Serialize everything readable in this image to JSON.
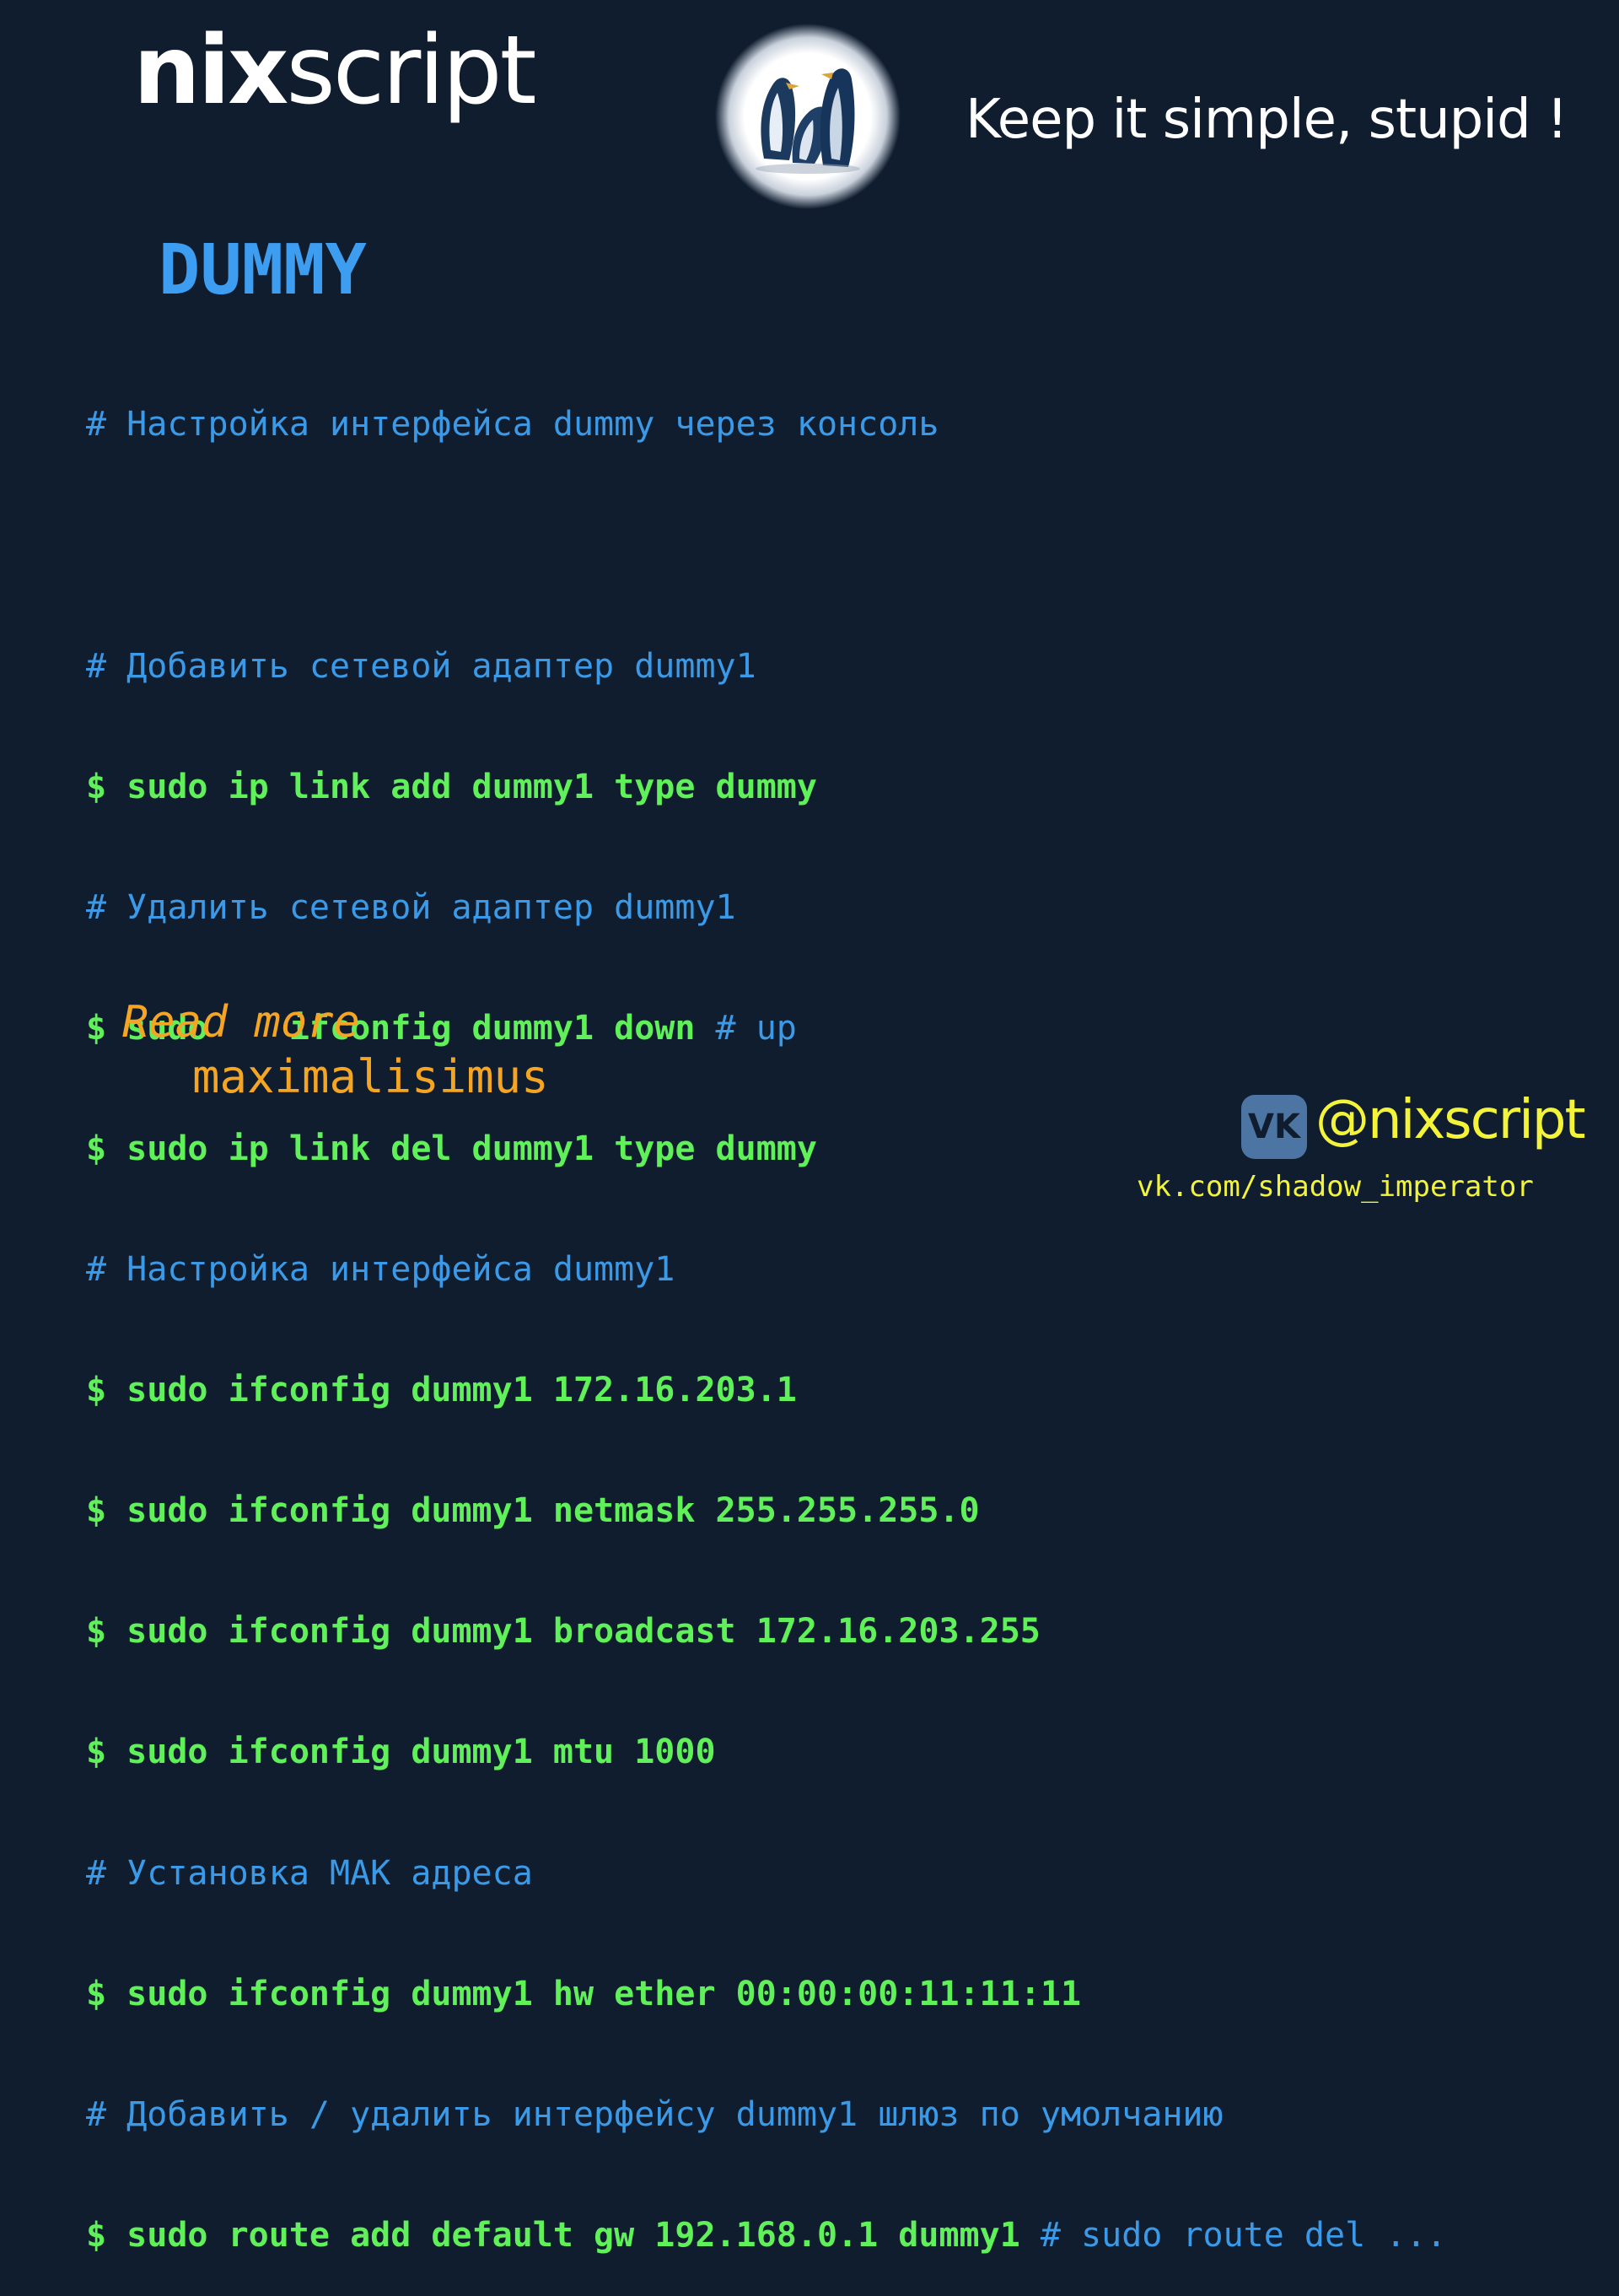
{
  "header": {
    "logo_bold": "nix",
    "logo_thin": "script",
    "motto": "Keep it simple, stupid !"
  },
  "title": "DUMMY",
  "code_lines": [
    {
      "type": "comment",
      "text": "# Настройка интерфейса dummy через консоль"
    },
    {
      "type": "blank",
      "text": ""
    },
    {
      "type": "comment",
      "text": "# Добавить сетевой адаптер dummy1"
    },
    {
      "type": "cmd",
      "text": "$ sudo ip link add dummy1 type dummy"
    },
    {
      "type": "comment",
      "text": "# Удалить сетевой адаптер dummy1"
    },
    {
      "type": "cmd",
      "text": "$ sudo    ifconfig dummy1 down",
      "trail": " # up"
    },
    {
      "type": "cmd",
      "text": "$ sudo ip link del dummy1 type dummy"
    },
    {
      "type": "comment",
      "text": "# Настройка интерфейса dummy1"
    },
    {
      "type": "cmd",
      "text": "$ sudo ifconfig dummy1 172.16.203.1"
    },
    {
      "type": "cmd",
      "text": "$ sudo ifconfig dummy1 netmask 255.255.255.0"
    },
    {
      "type": "cmd",
      "text": "$ sudo ifconfig dummy1 broadcast 172.16.203.255"
    },
    {
      "type": "cmd",
      "text": "$ sudo ifconfig dummy1 mtu 1000"
    },
    {
      "type": "comment",
      "text": "# Установка MAK адреса"
    },
    {
      "type": "cmd",
      "text": "$ sudo ifconfig dummy1 hw ether 00:00:00:11:11:11"
    },
    {
      "type": "comment",
      "text": "# Добавить / удалить интерфейсу dummy1 шлюз по умолчанию"
    },
    {
      "type": "cmd",
      "text": "$ sudo route add default gw 192.168.0.1 dummy1",
      "trail": " # sudo route del ..."
    }
  ],
  "footer": {
    "read_more": "Read more",
    "link": "maximalisimus",
    "vk_badge": "VK",
    "handle": "@nixscript",
    "vk_url": "vk.com/shadow_imperator"
  },
  "colors": {
    "background": "#0f1d2f",
    "comment": "#3b9ae8",
    "command": "#5ff05a",
    "title": "#3d9df0",
    "accent_orange": "#f5a524",
    "accent_yellow": "#f3f33a"
  }
}
